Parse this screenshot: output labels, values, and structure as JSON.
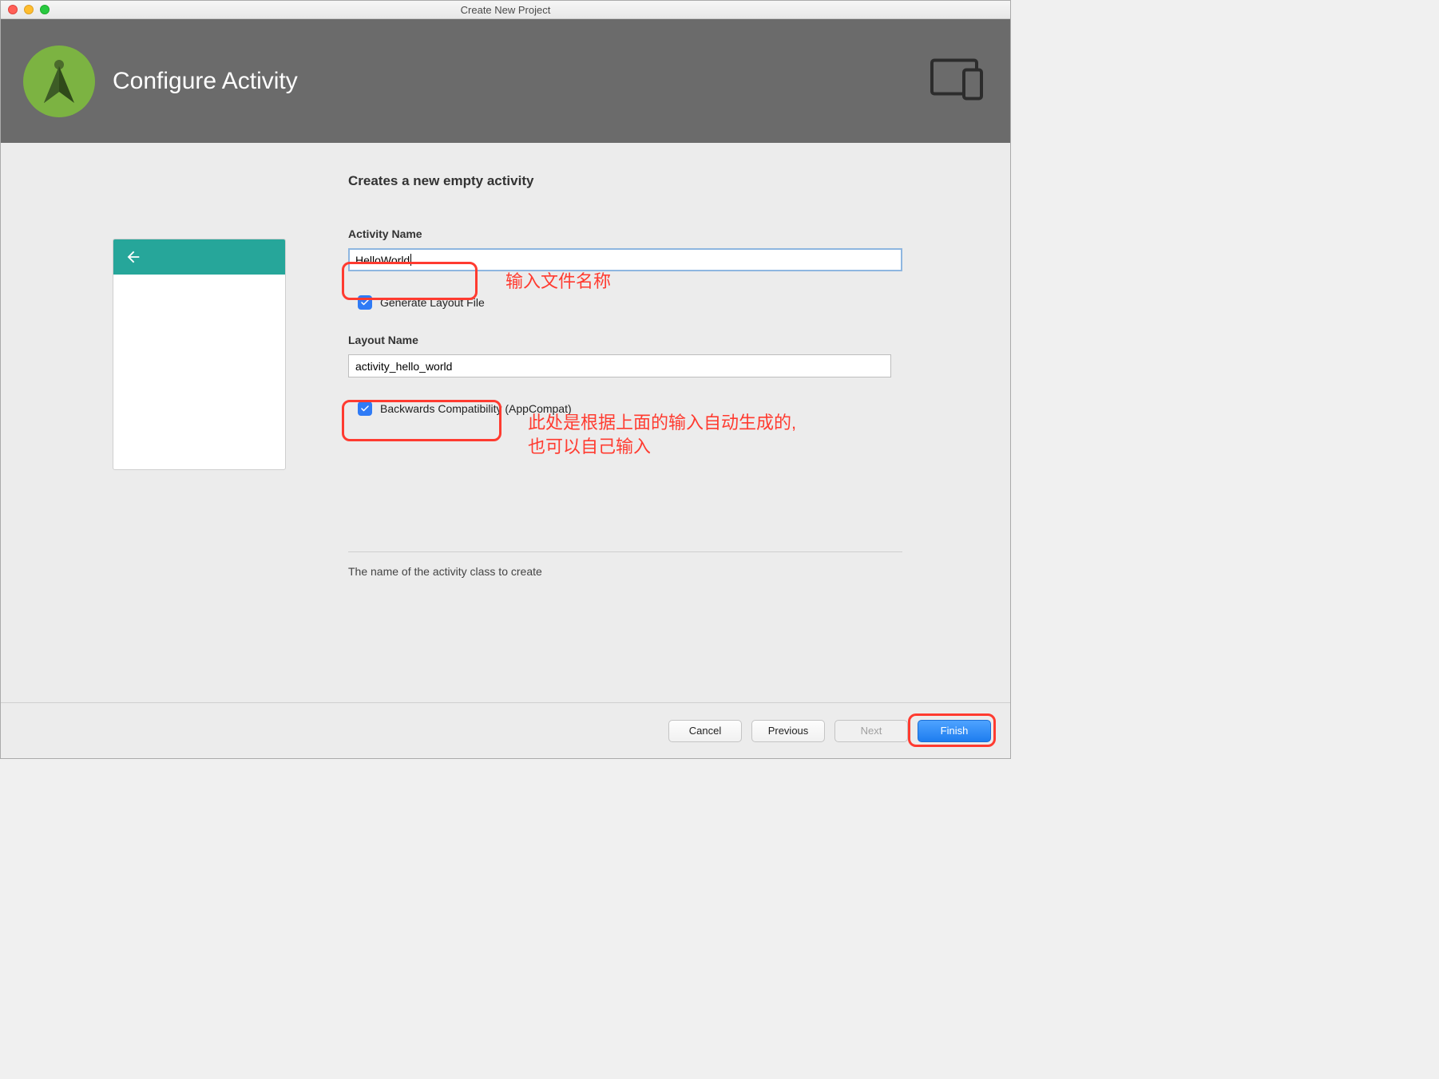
{
  "window": {
    "title": "Create New Project"
  },
  "header": {
    "title": "Configure Activity"
  },
  "section_title": "Creates a new empty activity",
  "fields": {
    "activity_name_label": "Activity Name",
    "activity_name_value": "HelloWorld",
    "generate_layout_label": "Generate Layout File",
    "generate_layout_checked": true,
    "layout_name_label": "Layout Name",
    "layout_name_value": "activity_hello_world",
    "backwards_compat_label": "Backwards Compatibility (AppCompat)",
    "backwards_compat_checked": true
  },
  "hint": "The name of the activity class to create",
  "annotations": {
    "a1": "输入文件名称",
    "a2_line1": "此处是根据上面的输入自动生成的,",
    "a2_line2": "也可以自己输入"
  },
  "buttons": {
    "cancel": "Cancel",
    "previous": "Previous",
    "next": "Next",
    "finish": "Finish"
  },
  "colors": {
    "header_bg": "#6b6b6b",
    "teal": "#26a69a",
    "annotation": "#ff3b30",
    "primary": "#1e7def"
  }
}
